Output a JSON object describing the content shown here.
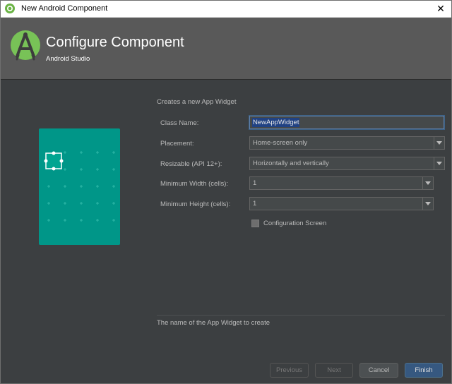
{
  "window": {
    "title": "New Android Component",
    "close_glyph": "✕"
  },
  "header": {
    "title": "Configure Component",
    "subtitle": "Android Studio",
    "logo_icon": "android-studio-logo"
  },
  "form": {
    "section_title": "Creates a new App Widget",
    "class_name": {
      "label": "Class Name:",
      "value": "NewAppWidget"
    },
    "placement": {
      "label": "Placement:",
      "value": "Home-screen only"
    },
    "resizable": {
      "label": "Resizable (API 12+):",
      "value": "Horizontally and vertically"
    },
    "min_width": {
      "label": "Minimum Width (cells):",
      "value": "1"
    },
    "min_height": {
      "label": "Minimum Height (cells):",
      "value": "1"
    },
    "config_screen": {
      "label": "Configuration Screen",
      "checked": false
    }
  },
  "help_text": "The name of the App Widget to create",
  "buttons": {
    "previous": "Previous",
    "next": "Next",
    "cancel": "Cancel",
    "finish": "Finish"
  },
  "colors": {
    "accent": "#009688",
    "background": "#3c3f41",
    "header": "#595959",
    "primary_button": "#365880"
  }
}
